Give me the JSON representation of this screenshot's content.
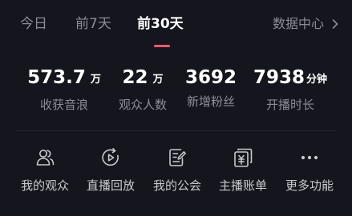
{
  "tabs": [
    {
      "label": "今日"
    },
    {
      "label": "前7天"
    },
    {
      "label": "前30天"
    }
  ],
  "active_tab": "前30天",
  "data_center": {
    "label": "数据中心"
  },
  "stats": [
    {
      "value": "573.7",
      "unit": "万",
      "label": "收获音浪"
    },
    {
      "value": "22",
      "unit": "万",
      "label": "观众人数"
    },
    {
      "value": "3692",
      "unit": "",
      "label": "新增粉丝"
    },
    {
      "value": "7938",
      "unit": "分钟",
      "label": "开播时长"
    }
  ],
  "actions": [
    {
      "label": "我的观众",
      "icon": "audience-icon"
    },
    {
      "label": "直播回放",
      "icon": "replay-icon"
    },
    {
      "label": "我的公会",
      "icon": "guild-icon"
    },
    {
      "label": "主播账单",
      "icon": "bill-icon"
    },
    {
      "label": "更多功能",
      "icon": "more-icon"
    }
  ],
  "colors": {
    "background": "#15151d",
    "text_primary": "#ffffff",
    "text_secondary": "#8d8d96",
    "accent": "#fe5a6f"
  }
}
